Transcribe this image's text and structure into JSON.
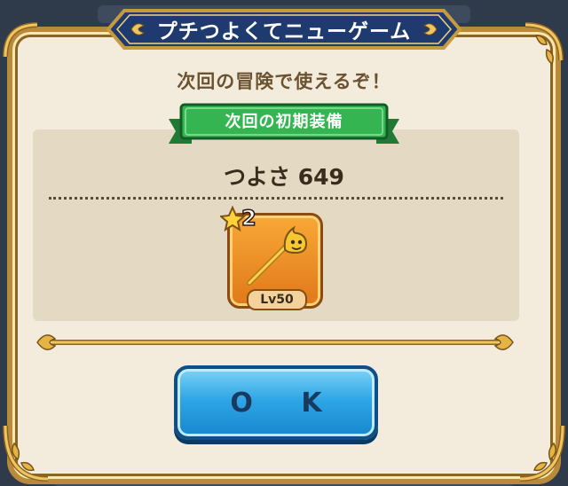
{
  "dialog": {
    "title": "プチつよくてニューゲーム",
    "subtitle": "次回の冒険で使えるぞ！",
    "ribbon_label": "次回の初期装備",
    "strength_text": "つよさ 649",
    "item": {
      "icon": "golden-slime-staff-icon",
      "stars": "2",
      "level": "Lv50"
    },
    "ok_label": "O K"
  },
  "colors": {
    "dialog_bg": "#f3ecdc",
    "frame_gold": "#b88a3a",
    "banner_navy": "#1e3a6e",
    "ribbon_green": "#2ea84a",
    "item_orange": "#f39a2c",
    "button_blue": "#2fa6e6"
  }
}
